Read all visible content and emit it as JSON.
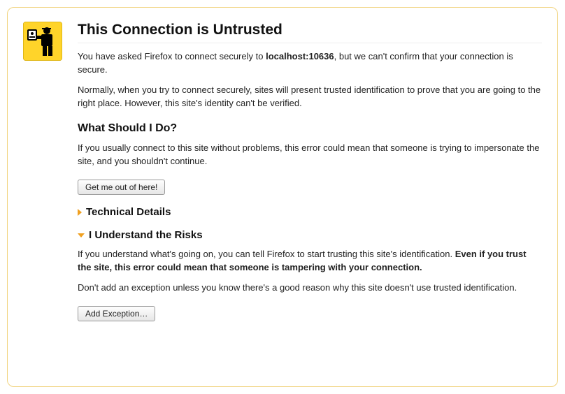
{
  "title": "This Connection is Untrusted",
  "intro": {
    "prefix": "You have asked Firefox to connect securely to ",
    "host": "localhost:10636",
    "suffix": ", but we can't confirm that your connection is secure."
  },
  "normally": "Normally, when you try to connect securely, sites will present trusted identification to prove that you are going to the right place. However, this site's identity can't be verified.",
  "what_heading": "What Should I Do?",
  "what_body": "If you usually connect to this site without problems, this error could mean that someone is trying to impersonate the site, and you shouldn't continue.",
  "get_out_label": "Get me out of here!",
  "tech_heading": "Technical Details",
  "risks_heading": "I Understand the Risks",
  "risks_body1_prefix": "If you understand what's going on, you can tell Firefox to start trusting this site's identification. ",
  "risks_body1_bold": "Even if you trust the site, this error could mean that someone is tampering with your connection.",
  "risks_body2": "Don't add an exception unless you know there's a good reason why this site doesn't use trusted identification.",
  "add_exception_label": "Add Exception…"
}
